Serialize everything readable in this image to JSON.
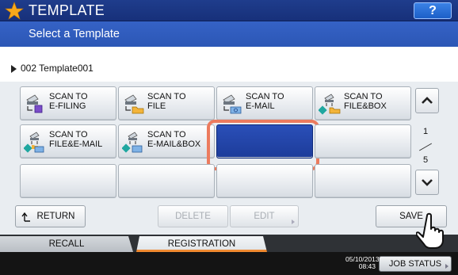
{
  "header": {
    "title": "TEMPLATE",
    "help_label": "?",
    "subtitle": "Select a Template"
  },
  "breadcrumb": {
    "text": "002 Template001"
  },
  "templates": [
    {
      "line1": "SCAN TO",
      "line2": "E-FILING",
      "icon": "scan-to-efiling-icon"
    },
    {
      "line1": "SCAN TO",
      "line2": "FILE",
      "icon": "scan-to-file-icon"
    },
    {
      "line1": "SCAN TO",
      "line2": "E-MAIL",
      "icon": "scan-to-email-icon"
    },
    {
      "line1": "SCAN TO",
      "line2": "FILE&BOX",
      "icon": "scan-to-filebox-icon"
    },
    {
      "line1": "SCAN TO",
      "line2": "FILE&E-MAIL",
      "icon": "scan-to-file-email-icon"
    },
    {
      "line1": "SCAN TO",
      "line2": "E-MAIL&BOX",
      "icon": "scan-to-email-box-icon"
    },
    {
      "line1": "",
      "line2": "",
      "selected": true
    },
    {
      "line1": "",
      "line2": ""
    },
    {
      "line1": "",
      "line2": ""
    },
    {
      "line1": "",
      "line2": ""
    },
    {
      "line1": "",
      "line2": ""
    },
    {
      "line1": "",
      "line2": ""
    }
  ],
  "pager": {
    "current": "1",
    "total": "5"
  },
  "actions": {
    "return_label": "RETURN",
    "delete_label": "DELETE",
    "edit_label": "EDIT",
    "save_label": "SAVE"
  },
  "tabs": {
    "recall": "RECALL",
    "registration": "REGISTRATION"
  },
  "footer": {
    "date": "05/10/2013",
    "time": "08:43",
    "job_status": "JOB STATUS"
  },
  "colors": {
    "header_dark": "#1f3d8c",
    "header_light": "#3562c6",
    "selected_tile": "#2a4fb8",
    "highlight_ring": "#ec7b5e",
    "tab_accent": "#f08a30",
    "star": "#f7a81b"
  }
}
